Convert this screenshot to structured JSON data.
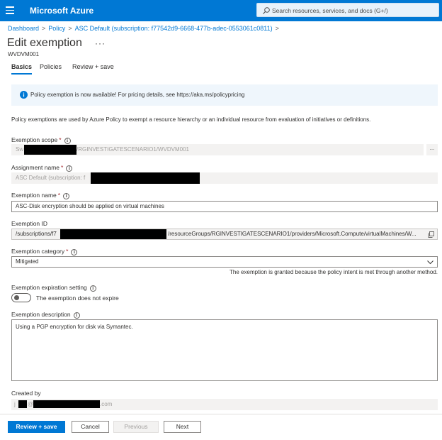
{
  "header": {
    "brand": "Microsoft Azure",
    "search_placeholder": "Search resources, services, and docs (G+/)"
  },
  "breadcrumb": {
    "items": [
      "Dashboard",
      "Policy",
      "ASC Default (subscription: f77542d9-6668-477b-adec-0553061c0811)"
    ],
    "separator": ">"
  },
  "page": {
    "title": "Edit exemption",
    "subtitle": "WVDVM001",
    "more_label": "···"
  },
  "tabs": [
    {
      "label": "Basics",
      "active": true
    },
    {
      "label": "Policies",
      "active": false
    },
    {
      "label": "Review + save",
      "active": false
    }
  ],
  "info_banner": {
    "text": "Policy exemption is now available! For pricing details, see https://aka.ms/policypricing"
  },
  "description": "Policy exemptions are used by Azure Policy to exempt a resource hierarchy or an individual resource from evaluation of initiatives or definitions.",
  "form": {
    "scope": {
      "label": "Exemption scope",
      "value_prefix": "Sw",
      "value_suffix": "/RGINVESTIGATESCENARIO1/WVDVM001",
      "button_label": "..."
    },
    "assignment": {
      "label": "Assignment name",
      "value_prefix": "ASC Default (subscription: f"
    },
    "exemption_name": {
      "label": "Exemption name",
      "value": "ASC-Disk encryption should be applied on virtual machines"
    },
    "exemption_id": {
      "label": "Exemption ID",
      "value_prefix": "/subscriptions/f7",
      "value_suffix": "/resourceGroups/RGINVESTIGATESCENARIO1/providers/Microsoft.Compute/virtualMachines/W..."
    },
    "category": {
      "label": "Exemption category",
      "value": "Mitigated",
      "helper": "The exemption is granted because the policy intent is met through another method."
    },
    "expiration": {
      "label": "Exemption expiration setting",
      "toggle_label": "The exemption does not expire",
      "enabled": false
    },
    "exemption_description": {
      "label": "Exemption description",
      "value": "Using a PGP encryption for disk via Symantec."
    },
    "created_by": {
      "label": "Created by",
      "value_prefix": "j",
      "value_mid": "@",
      "value_suffix": ".com"
    }
  },
  "footer": {
    "review_save": "Review + save",
    "cancel": "Cancel",
    "previous": "Previous",
    "next": "Next"
  },
  "colors": {
    "accent": "#0078d4",
    "info_bg": "#eff6fc",
    "required": "#a4262c",
    "redaction": "#000000"
  }
}
